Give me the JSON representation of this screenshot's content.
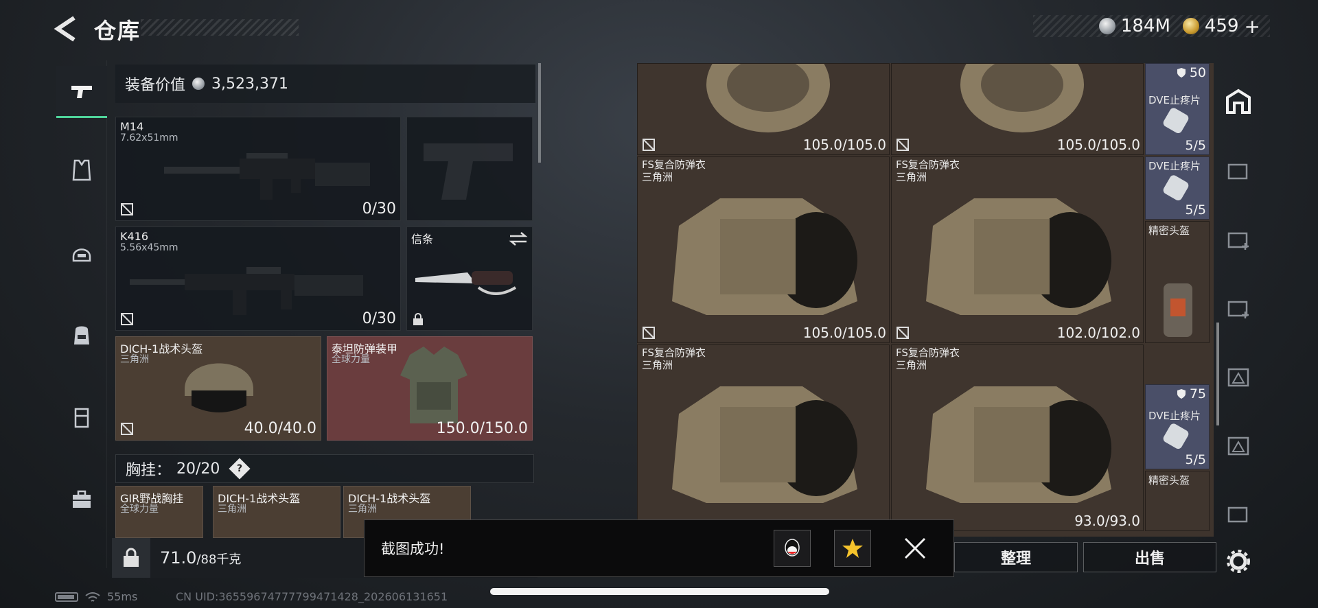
{
  "header": {
    "title": "仓库",
    "currency_silver": "184M",
    "currency_gold": "459"
  },
  "left_nav": {
    "items": [
      "weapons-icon",
      "armor-icon",
      "helmet-icon",
      "backpack-icon",
      "chest-rig-icon",
      "case-icon"
    ]
  },
  "loadout": {
    "value_label": "装备价值",
    "value_amount": "3,523,371",
    "primary_weapon": {
      "name": "M14",
      "caliber": "7.62x51mm",
      "ammo": "0/30"
    },
    "secondary_weapon": {
      "name": "K416",
      "caliber": "5.56x45mm",
      "ammo": "0/30"
    },
    "pistol_slot": {
      "name": ""
    },
    "melee_slot": {
      "name": "信条"
    },
    "helmet": {
      "name": "DICH-1战术头盔",
      "origin": "三角洲",
      "durability": "40.0/40.0"
    },
    "armor": {
      "name": "泰坦防弹装甲",
      "origin": "全球力量",
      "durability": "150.0/150.0"
    },
    "chest_rig": {
      "label": "胸挂：",
      "count": "20/20",
      "help": "?"
    },
    "rig_items": [
      {
        "name": "GIR野战胸挂",
        "origin": "全球力量"
      },
      {
        "name": "DICH-1战术头盔",
        "origin": "三角洲"
      },
      {
        "name": "DICH-1战术头盔",
        "origin": "三角洲"
      }
    ],
    "weight": "71.0",
    "weight_max": "/88千克"
  },
  "stash": {
    "cells": [
      {
        "name": "",
        "origin": "",
        "durability": "105.0/105.0"
      },
      {
        "name": "",
        "origin": "",
        "durability": "105.0/105.0"
      },
      {
        "name": "FS复合防弹衣",
        "origin": "三角洲",
        "durability": "105.0/105.0"
      },
      {
        "name": "FS复合防弹衣",
        "origin": "三角洲",
        "durability": "102.0/102.0"
      },
      {
        "name": "FS复合防弹衣",
        "origin": "三角洲",
        "durability": ""
      },
      {
        "name": "FS复合防弹衣",
        "origin": "三角洲",
        "durability": "93.0/93.0"
      }
    ],
    "mini": [
      {
        "name": "DVE止疼片",
        "top": "50",
        "count": "5/5"
      },
      {
        "name": "DVE止疼片",
        "top": "",
        "count": "5/5"
      },
      {
        "name": "精密头盔",
        "top": "",
        "count": ""
      },
      {
        "name": "DVE止疼片",
        "top": "75",
        "count": "5/5"
      },
      {
        "name": "精密头盔",
        "top": "",
        "count": ""
      }
    ]
  },
  "actions": {
    "sort": "整理",
    "sell": "出售"
  },
  "toast": {
    "message": "截图成功!",
    "share_qq": "qq-icon",
    "share_qzone": "qzone-icon"
  },
  "status": {
    "ping": "55ms",
    "uid": "CN UID:36559674777799471428_202606131651"
  },
  "colors": {
    "accent": "#4fd39a",
    "cell_brown": "#3f352e",
    "armor_red": "#6a3d3e",
    "pill_slot": "#4a4f68"
  }
}
